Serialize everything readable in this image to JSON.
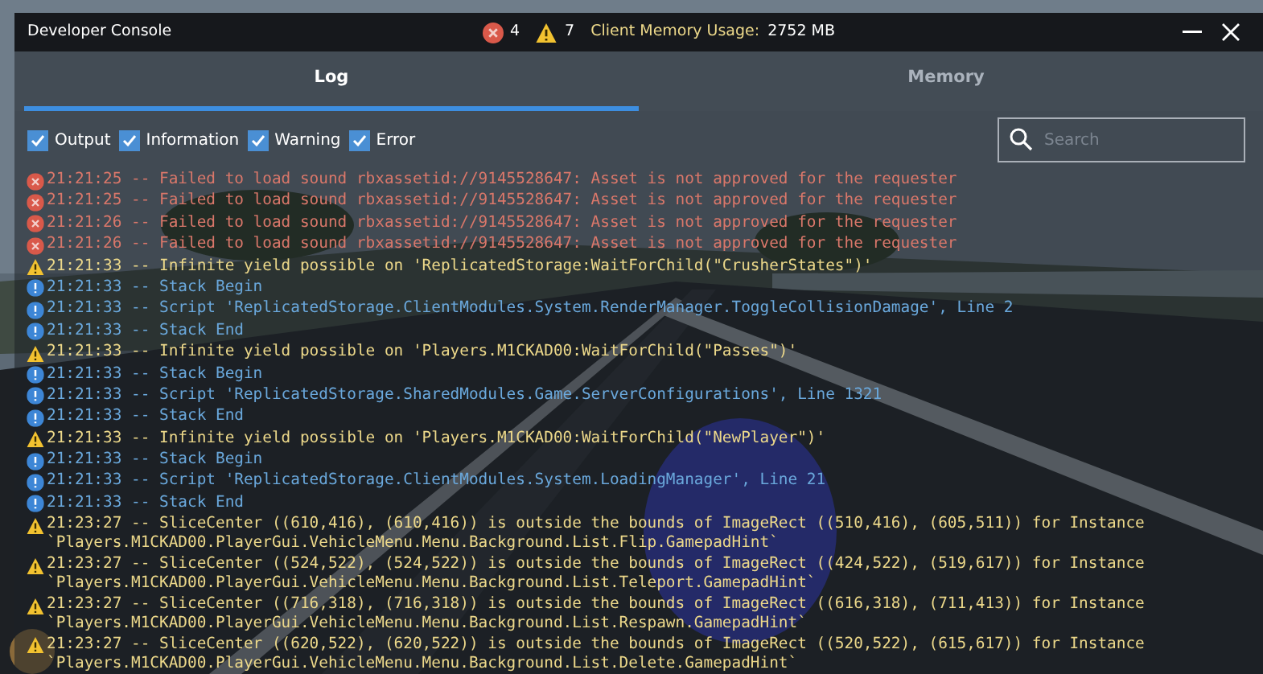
{
  "window": {
    "title": "Developer Console"
  },
  "header": {
    "error_count": "4",
    "warning_count": "7",
    "memory_label": "Client Memory Usage:",
    "memory_value": "2752 MB"
  },
  "tabs": [
    {
      "label": "Log",
      "selected": true
    },
    {
      "label": "Memory",
      "selected": false
    }
  ],
  "filters": [
    {
      "label": "Output",
      "checked": true
    },
    {
      "label": "Information",
      "checked": true
    },
    {
      "label": "Warning",
      "checked": true
    },
    {
      "label": "Error",
      "checked": true
    }
  ],
  "search": {
    "placeholder": "Search"
  },
  "log": [
    {
      "kind": "error",
      "text": "21:21:25 -- Failed to load sound rbxassetid://9145528647: Asset is not approved for the requester"
    },
    {
      "kind": "error",
      "text": "21:21:25 -- Failed to load sound rbxassetid://9145528647: Asset is not approved for the requester"
    },
    {
      "kind": "error",
      "text": "21:21:26 -- Failed to load sound rbxassetid://9145528647: Asset is not approved for the requester"
    },
    {
      "kind": "error",
      "text": "21:21:26 -- Failed to load sound rbxassetid://9145528647: Asset is not approved for the requester"
    },
    {
      "kind": "warning",
      "text": "21:21:33 -- Infinite yield possible on 'ReplicatedStorage:WaitForChild(\"CrusherStates\")'"
    },
    {
      "kind": "info",
      "text": "21:21:33 -- Stack Begin"
    },
    {
      "kind": "info",
      "text": "21:21:33 -- Script 'ReplicatedStorage.ClientModules.System.RenderManager.ToggleCollisionDamage', Line 2"
    },
    {
      "kind": "info",
      "text": "21:21:33 -- Stack End"
    },
    {
      "kind": "warning",
      "text": "21:21:33 -- Infinite yield possible on 'Players.M1CKAD00:WaitForChild(\"Passes\")'"
    },
    {
      "kind": "info",
      "text": "21:21:33 -- Stack Begin"
    },
    {
      "kind": "info",
      "text": "21:21:33 -- Script 'ReplicatedStorage.SharedModules.Game.ServerConfigurations', Line 1321"
    },
    {
      "kind": "info",
      "text": "21:21:33 -- Stack End"
    },
    {
      "kind": "warning",
      "text": "21:21:33 -- Infinite yield possible on 'Players.M1CKAD00:WaitForChild(\"NewPlayer\")'"
    },
    {
      "kind": "info",
      "text": "21:21:33 -- Stack Begin"
    },
    {
      "kind": "info",
      "text": "21:21:33 -- Script 'ReplicatedStorage.ClientModules.System.LoadingManager', Line 21"
    },
    {
      "kind": "info",
      "text": "21:21:33 -- Stack End"
    },
    {
      "kind": "warning",
      "text": "21:23:27 -- SliceCenter ((610,416), (610,416)) is outside the bounds of ImageRect ((510,416), (605,511)) for Instance `Players.M1CKAD00.PlayerGui.VehicleMenu.Menu.Background.List.Flip.GamepadHint`"
    },
    {
      "kind": "warning",
      "text": "21:23:27 -- SliceCenter ((524,522), (524,522)) is outside the bounds of ImageRect ((424,522), (519,617)) for Instance `Players.M1CKAD00.PlayerGui.VehicleMenu.Menu.Background.List.Teleport.GamepadHint`"
    },
    {
      "kind": "warning",
      "text": "21:23:27 -- SliceCenter ((716,318), (716,318)) is outside the bounds of ImageRect ((616,318), (711,413)) for Instance `Players.M1CKAD00.PlayerGui.VehicleMenu.Menu.Background.List.Respawn.GamepadHint`"
    },
    {
      "kind": "warning",
      "text": "21:23:27 -- SliceCenter ((620,522), (620,522)) is outside the bounds of ImageRect ((520,522), (615,617)) for Instance `Players.M1CKAD00.PlayerGui.VehicleMenu.Menu.Background.List.Delete.GamepadHint`"
    }
  ]
}
